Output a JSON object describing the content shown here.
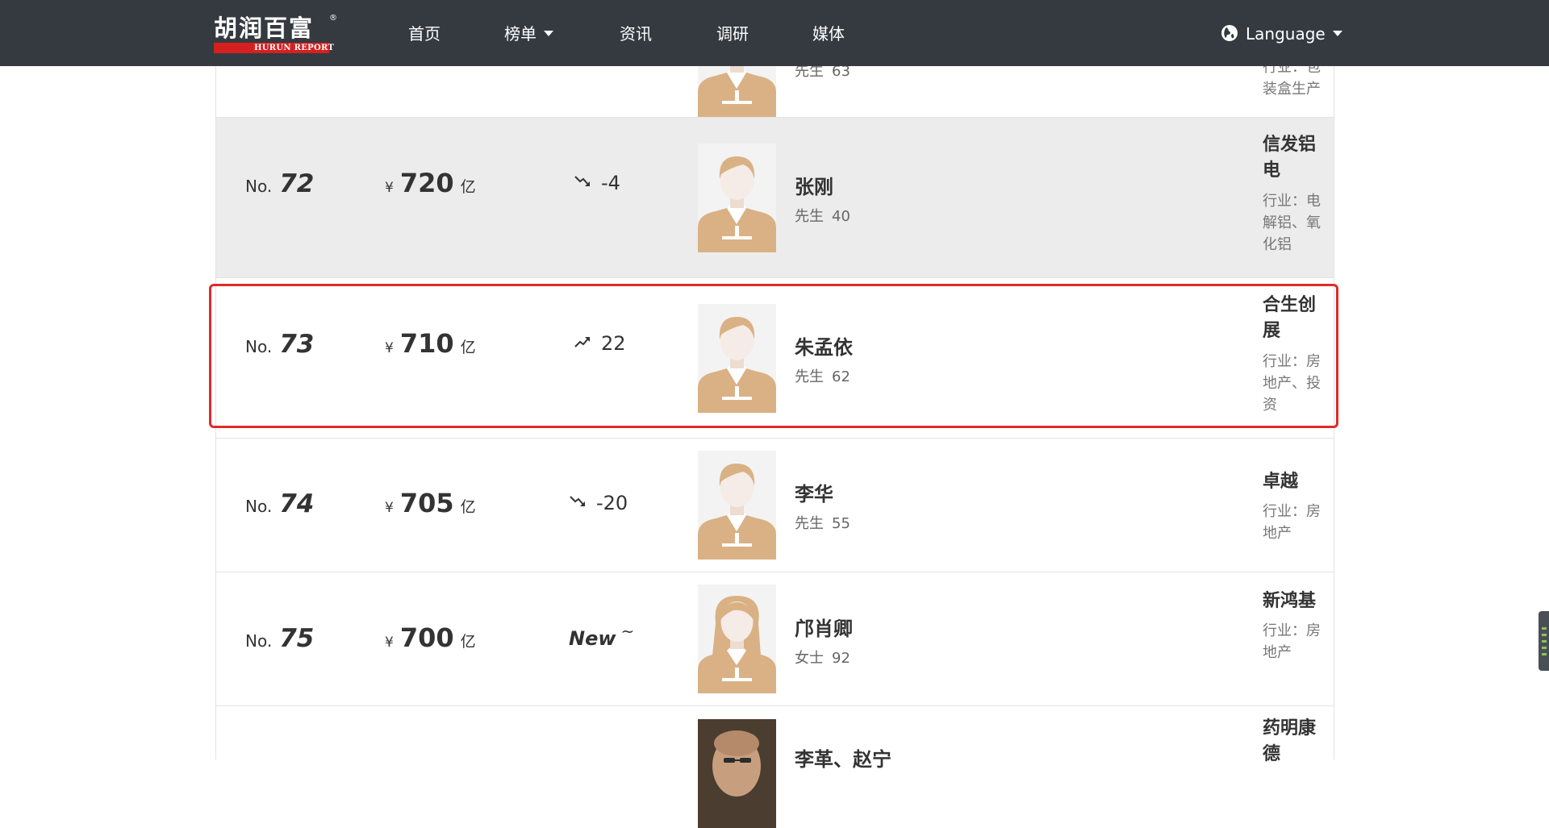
{
  "navbar": {
    "logo_cn": "胡润百富",
    "logo_en": "HURUN REPORT",
    "logo_reg": "®",
    "items": [
      {
        "label": "首页",
        "dropdown": false
      },
      {
        "label": "榜单",
        "dropdown": true
      },
      {
        "label": "资讯",
        "dropdown": false
      },
      {
        "label": "调研",
        "dropdown": false
      },
      {
        "label": "媒体",
        "dropdown": false
      }
    ],
    "language_label": "Language"
  },
  "rank_prefix": "No.",
  "currency_symbol": "¥",
  "wealth_unit": "亿",
  "industry_prefix": "行业：",
  "rows": [
    {
      "rank": "",
      "wealth": "",
      "change": "",
      "change_dir": "",
      "name": "",
      "gender": "先生",
      "age": "63",
      "company": "",
      "industry": "行业：包装盒生产",
      "industry_visible": "行业：包\n装盒生产",
      "avatar": "male"
    },
    {
      "rank": "72",
      "wealth": "720",
      "change": "-4",
      "change_dir": "down",
      "name": "张刚",
      "gender": "先生",
      "age": "40",
      "company": "信发铝电",
      "industry": "行业：电解铝、氧化铝",
      "avatar": "male"
    },
    {
      "rank": "73",
      "wealth": "710",
      "change": "22",
      "change_dir": "up",
      "name": "朱孟依",
      "gender": "先生",
      "age": "62",
      "company": "合生创展",
      "industry": "行业：房地产、投资",
      "avatar": "male",
      "highlighted": true
    },
    {
      "rank": "74",
      "wealth": "705",
      "change": "-20",
      "change_dir": "down",
      "name": "李华",
      "gender": "先生",
      "age": "55",
      "company": "卓越",
      "industry": "行业：房地产",
      "avatar": "male"
    },
    {
      "rank": "75",
      "wealth": "700",
      "change": "New",
      "change_dir": "new",
      "change_suffix": "~",
      "name": "邝肖卿",
      "gender": "女士",
      "age": "92",
      "company": "新鸿基",
      "industry": "行业：房地产",
      "avatar": "female"
    },
    {
      "rank": "",
      "wealth": "",
      "change": "",
      "change_dir": "",
      "name": "李革、赵宁",
      "gender": "",
      "age": "",
      "company": "药明康德",
      "industry": "",
      "avatar": "photo"
    }
  ],
  "colors": {
    "navbar_bg": "#343a40",
    "row_shaded": "#ececec",
    "highlight_border": "#e02a2a",
    "avatar_body": "#d9b184"
  }
}
